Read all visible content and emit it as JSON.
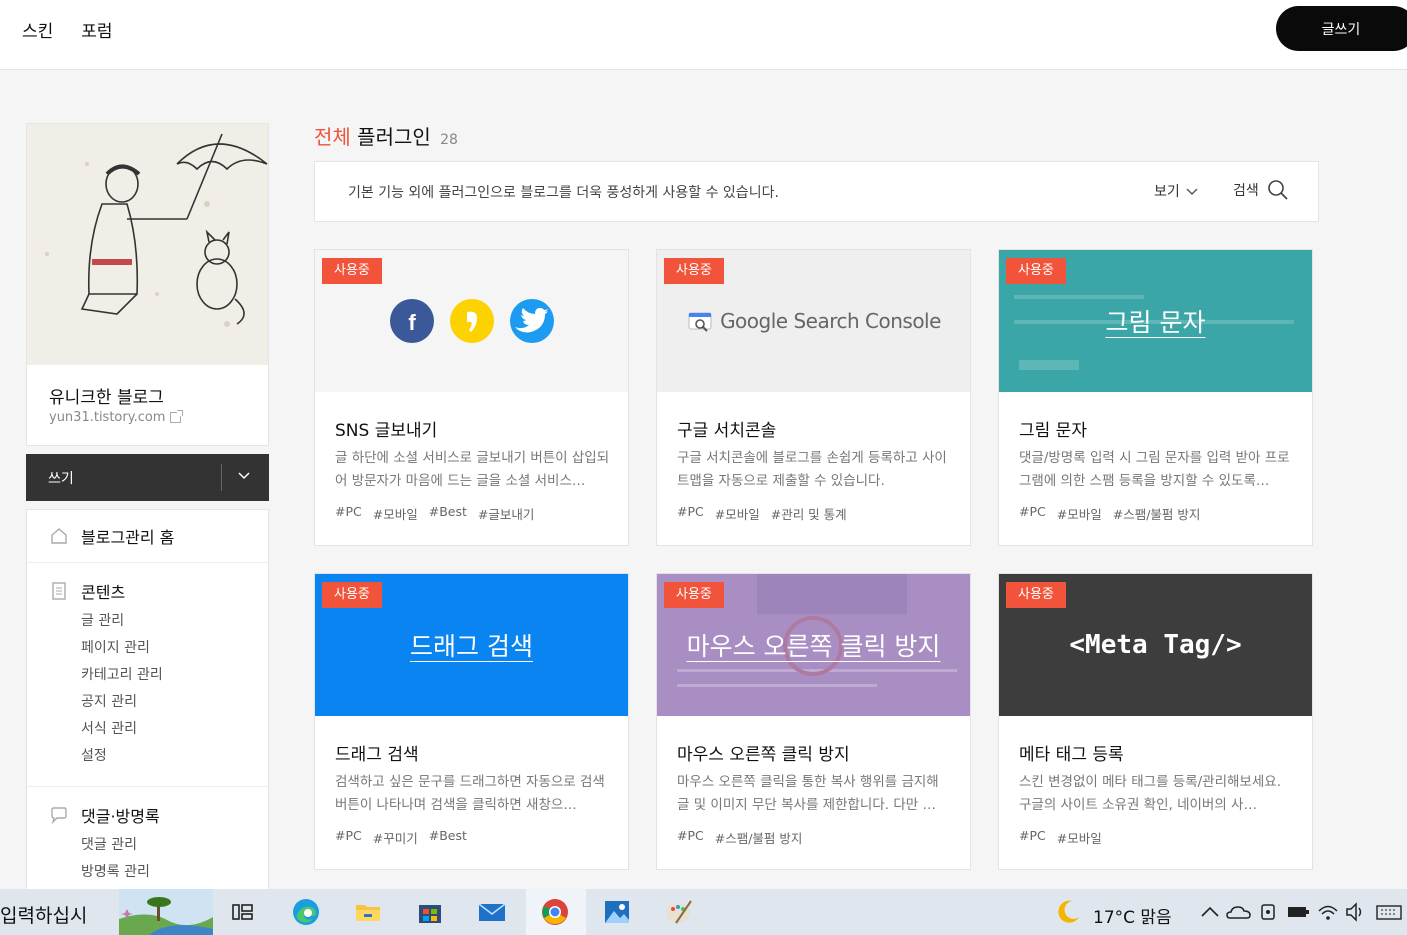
{
  "topbar": {
    "nav": [
      "스킨",
      "포럼"
    ],
    "write_button": "글쓰기"
  },
  "sidebar": {
    "blog_name": "유니크한 블로그",
    "blog_url": "yun31.tistory.com",
    "write_label": "쓰기",
    "menu": {
      "home": "블로그관리 홈",
      "contents": {
        "title": "콘텐츠",
        "items": [
          "글 관리",
          "페이지 관리",
          "카테고리 관리",
          "공지 관리",
          "서식 관리",
          "설정"
        ]
      },
      "comments": {
        "title": "댓글·방명록",
        "items": [
          "댓글 관리",
          "방명록 관리"
        ]
      }
    }
  },
  "main": {
    "title_highlight": "전체",
    "title_rest": "플러그인",
    "count": "28",
    "description": "기본 기능 외에 플러그인으로 블로그를 더욱 풍성하게 사용할 수 있습니다.",
    "view_label": "보기",
    "search_label": "검색",
    "cards": [
      {
        "badge": "사용중",
        "name": "SNS 글보내기",
        "desc": "글 하단에 소셜 서비스로 글보내기 버튼이 삽입되어 방문자가 마음에 드는 글을 소셜 서비스…",
        "tags": [
          "#PC",
          "#모바일",
          "#Best",
          "#글보내기"
        ]
      },
      {
        "badge": "사용중",
        "name": "구글 서치콘솔",
        "desc": "구글 서치콘솔에 블로그를 손쉽게 등록하고 사이트맵을 자동으로 제출할 수 있습니다.",
        "tags": [
          "#PC",
          "#모바일",
          "#관리 및 통계"
        ],
        "thumb_text": "Google Search Console"
      },
      {
        "badge": "사용중",
        "name": "그림 문자",
        "desc": "댓글/방명록 입력 시 그림 문자를 입력 받아 프로그램에 의한 스팸 등록을 방지할 수 있도록…",
        "tags": [
          "#PC",
          "#모바일",
          "#스팸/불펌 방지"
        ],
        "thumb_text": "그림 문자"
      },
      {
        "badge": "사용중",
        "name": "드래그 검색",
        "desc": "검색하고 싶은 문구를 드래그하면 자동으로 검색 버튼이 나타나며 검색을 클릭하면 새창으…",
        "tags": [
          "#PC",
          "#꾸미기",
          "#Best"
        ],
        "thumb_text": "드래그 검색"
      },
      {
        "badge": "사용중",
        "name": "마우스 오른쪽 클릭 방지",
        "desc": "마우스 오른쪽 클릭을 통한 복사 행위를 금지해 글 및 이미지 무단 복사를 제한합니다. 다만 …",
        "tags": [
          "#PC",
          "#스팸/불펌 방지"
        ],
        "thumb_text": "마우스 오른쪽 클릭 방지"
      },
      {
        "badge": "사용중",
        "name": "메타 태그 등록",
        "desc": "스킨 변경없이 메타 태그를 등록/관리해보세요. 구글의 사이트 소유권 확인, 네이버의 사…",
        "tags": [
          "#PC",
          "#모바일"
        ],
        "thumb_text": "<Meta Tag/>"
      }
    ]
  },
  "taskbar": {
    "input_text": "입력하십시",
    "weather": "17°C 맑음",
    "icons": [
      "task-view-icon",
      "edge-icon",
      "file-explorer-icon",
      "store-icon",
      "mail-icon",
      "chrome-icon",
      "photos-icon",
      "paint-icon"
    ]
  },
  "colors": {
    "accent": "#f2543b",
    "dark": "#333333"
  }
}
